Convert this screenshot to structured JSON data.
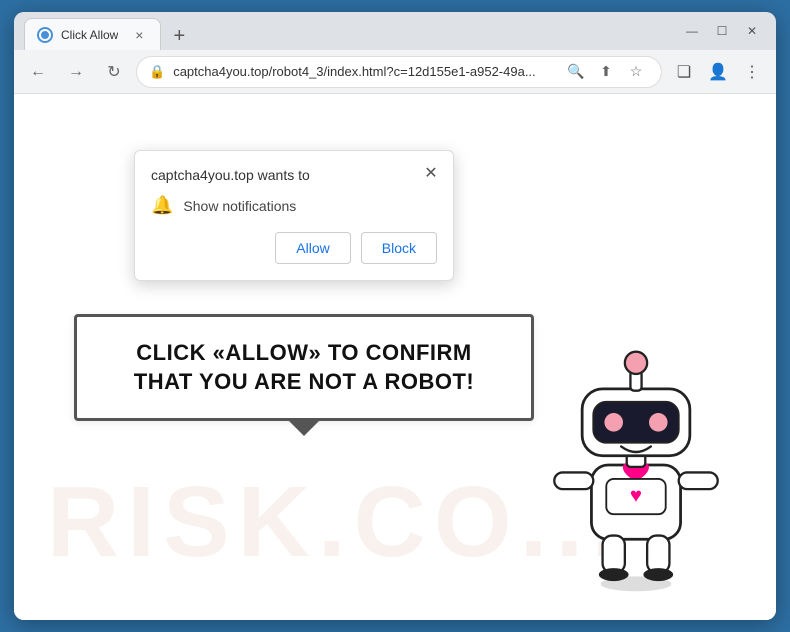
{
  "window": {
    "title": "Click Allow",
    "tab_title": "Click Allow",
    "close_label": "×",
    "new_tab_label": "+"
  },
  "titlebar": {
    "minimize": "—",
    "maximize": "☐",
    "close": "✕"
  },
  "nav": {
    "back_label": "←",
    "forward_label": "→",
    "refresh_label": "↻",
    "url": "captcha4you.top/robot4_3/index.html?c=12d155e1-a952-49a...",
    "search_label": "🔍",
    "share_label": "⬆",
    "bookmark_label": "☆",
    "split_label": "❏",
    "profile_label": "👤",
    "menu_label": "⋮"
  },
  "popup": {
    "title": "captcha4you.top wants to",
    "notification_text": "Show notifications",
    "allow_label": "Allow",
    "block_label": "Block"
  },
  "main_text": "CLICK «ALLOW» TO CONFIRM THAT YOU ARE NOT A ROBOT!",
  "watermark": "RISK.CO..."
}
